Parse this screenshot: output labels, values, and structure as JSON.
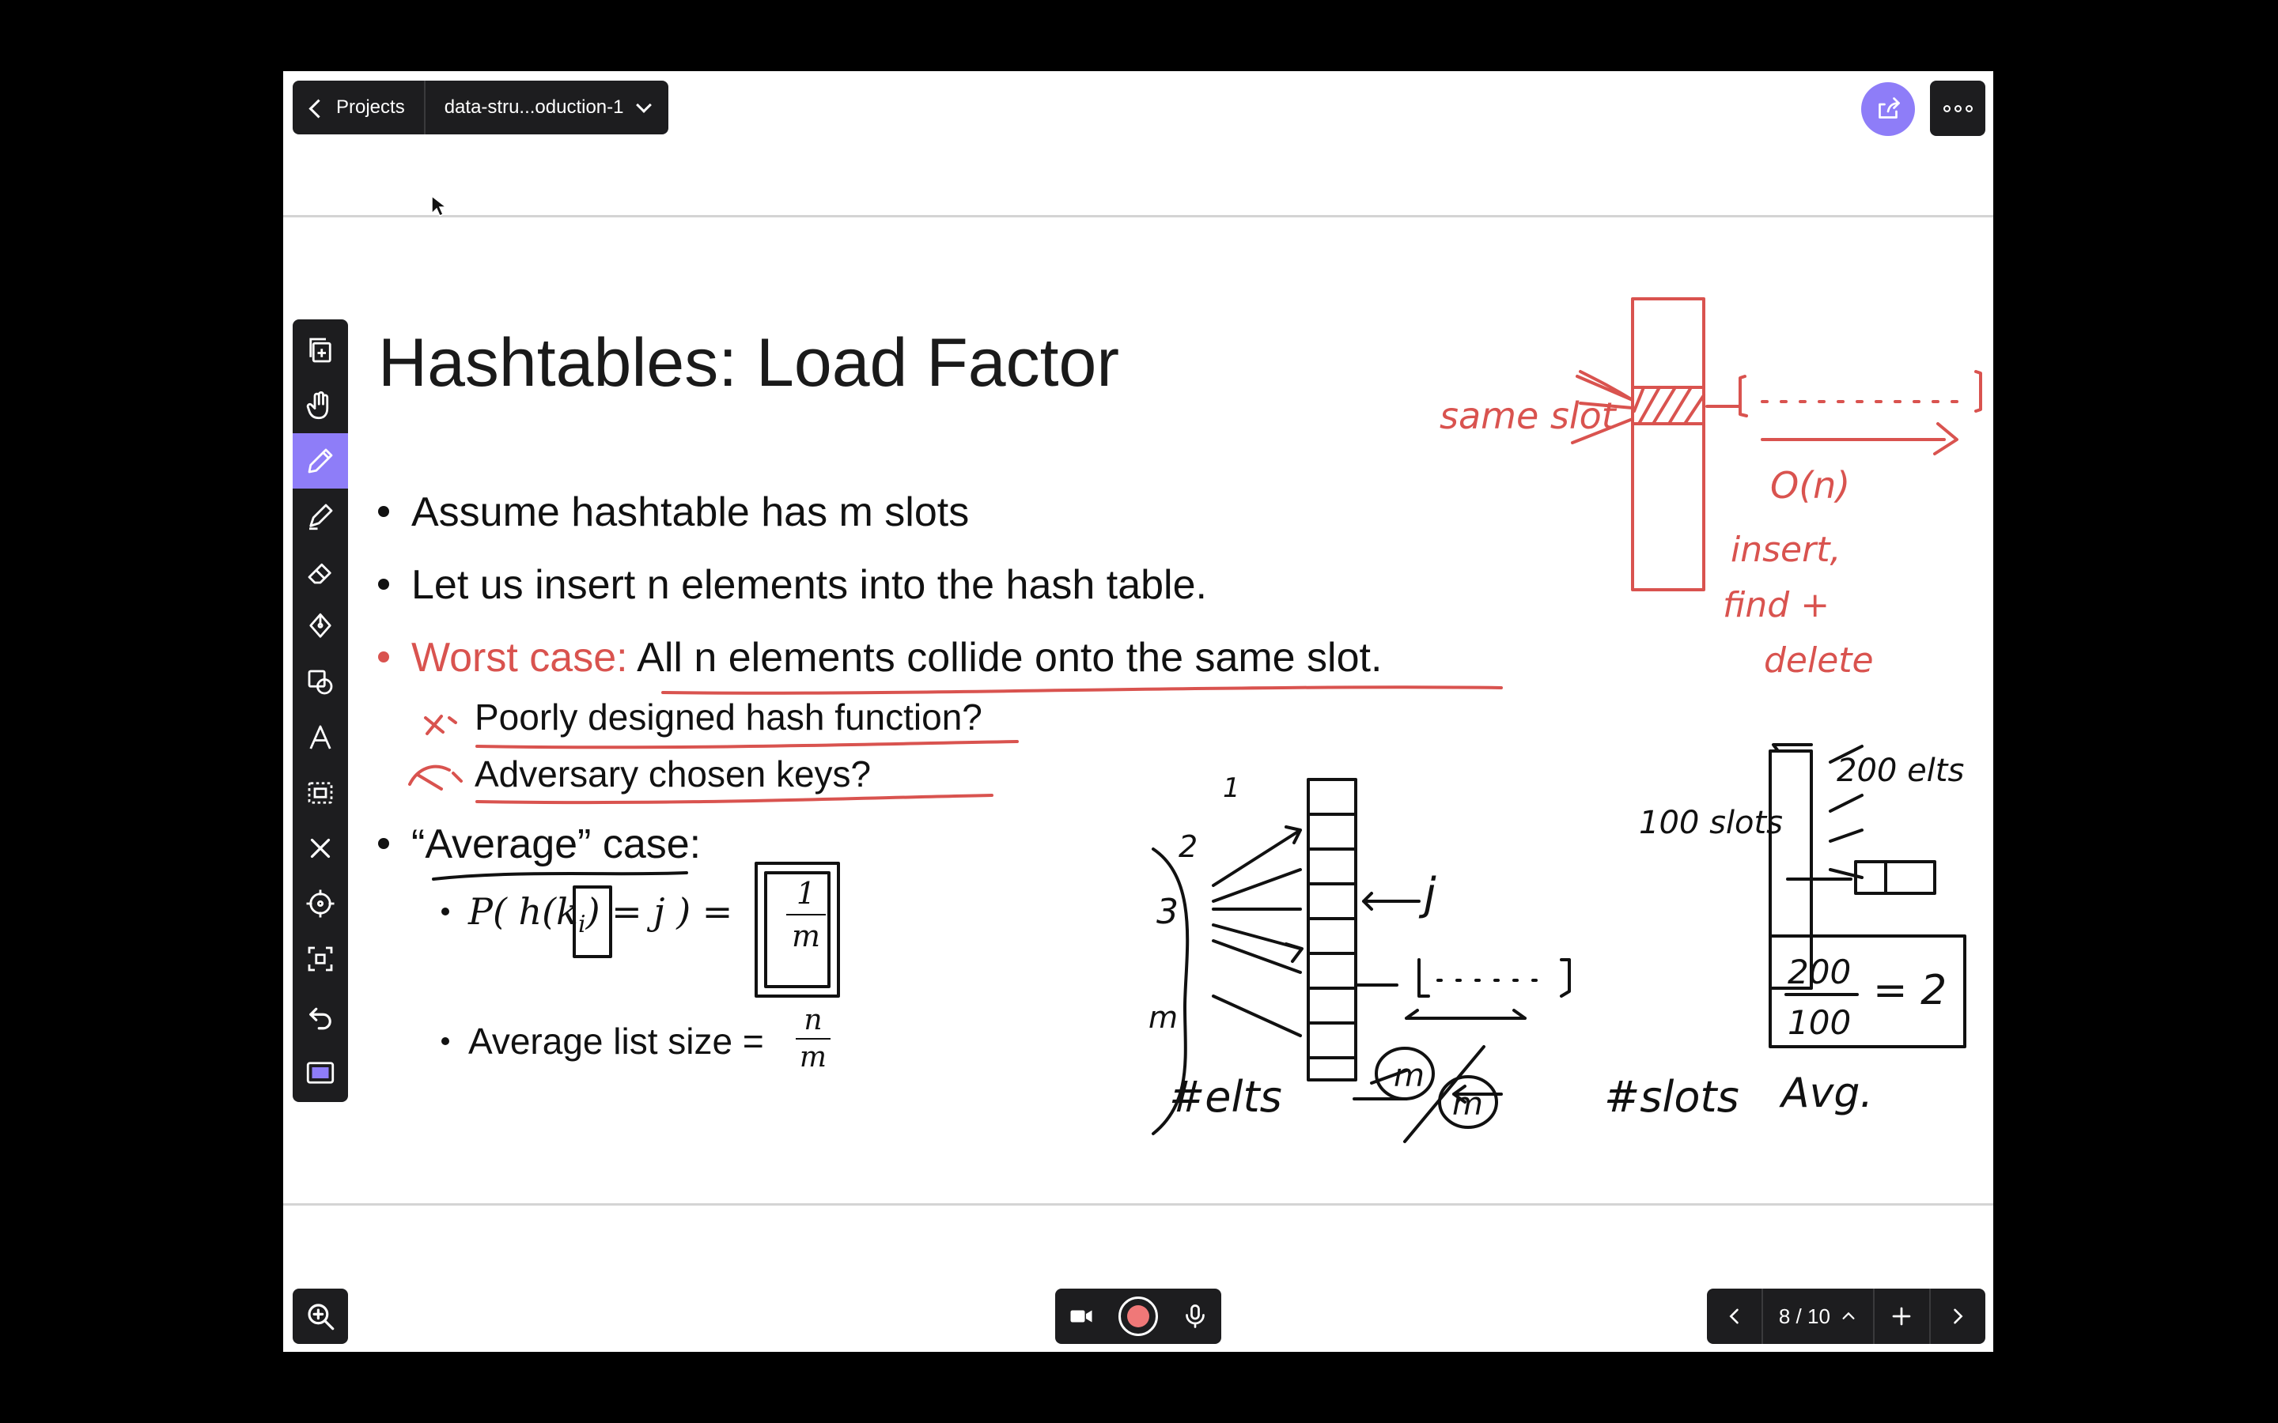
{
  "topbar": {
    "back_label": "Projects",
    "file_name": "data-stru...oduction-1"
  },
  "toolbar": {
    "tools": [
      "copy-page",
      "hand",
      "pen",
      "highlighter",
      "eraser",
      "fill",
      "shapes",
      "text",
      "lasso",
      "clear",
      "laser-pointer",
      "select-area",
      "undo",
      "screen-capture"
    ],
    "active_tool": "pen",
    "active_color": "#8e7df8"
  },
  "slide": {
    "title": "Hashtables: Load Factor",
    "bullets": {
      "b1": "Assume hashtable has m slots",
      "b2": "Let us insert n elements into the hash table.",
      "b3_label": "Worst case:",
      "b3_text": "All n elements collide onto the same slot.",
      "sub1": "Poorly designed hash function?",
      "sub2": "Adversary chosen keys?",
      "b4": "“Average” case:",
      "formula_prob_left": "P( h(k",
      "formula_prob_sub": "i",
      "formula_prob_right": ") = j ) =",
      "formula_num": "1",
      "formula_den": "m",
      "avg_label": "Average list size =",
      "avg_num": "n",
      "avg_den": "m"
    },
    "accent_color": "#d9534f"
  },
  "annotations": {
    "red": [
      "same slot",
      "O(n)",
      "insert,",
      "find +",
      "delete"
    ],
    "black": [
      "1",
      "2",
      "3",
      "m",
      "j",
      "#elts",
      "#slots",
      "100 slots",
      "200 elts",
      "200",
      "100",
      "= 2",
      "Avg."
    ]
  },
  "pager": {
    "page": "8 / 10"
  }
}
